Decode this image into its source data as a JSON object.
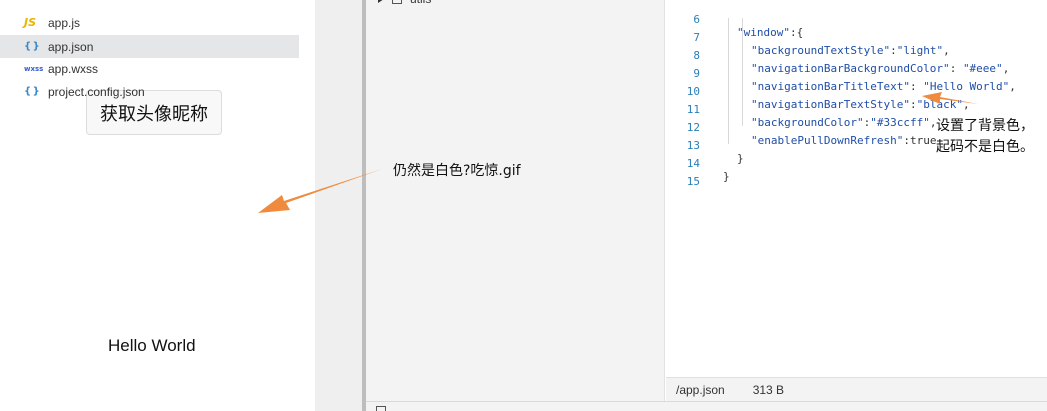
{
  "simulator": {
    "button_label": "获取头像昵称",
    "hello_text": "Hello World"
  },
  "file_tree": {
    "items": [
      {
        "icon": "JS",
        "name": "app.js",
        "selected": false
      },
      {
        "icon": "{ }",
        "name": "app.json",
        "selected": true
      },
      {
        "icon": "wxss",
        "name": "app.wxss",
        "selected": false
      },
      {
        "icon": "{ }",
        "name": "project.config.json",
        "selected": false
      }
    ],
    "folder_top": "utils"
  },
  "editor": {
    "lines": [
      {
        "num": "6",
        "text": "\"window\":{"
      },
      {
        "num": "7",
        "text": "\"backgroundTextStyle\":\"light\","
      },
      {
        "num": "8",
        "text": "\"navigationBarBackgroundColor\": \"#eee\","
      },
      {
        "num": "9",
        "text": "\"navigationBarTitleText\": \"Hello World\","
      },
      {
        "num": "10",
        "text": "\"navigationBarTextStyle\":\"black\","
      },
      {
        "num": "11",
        "text": "\"backgroundColor\":\"#33ccff\","
      },
      {
        "num": "12",
        "text": "\"enablePullDownRefresh\":true"
      },
      {
        "num": "13",
        "text": "}"
      },
      {
        "num": "14",
        "text": "}"
      },
      {
        "num": "15",
        "text": ""
      }
    ]
  },
  "statusbar": {
    "path": "/app.json",
    "size": "313 B"
  },
  "annotations": {
    "left_note": "仍然是白色?吃惊.gif",
    "right_note": "设置了背景色，起码不是白色。"
  },
  "colors": {
    "arrow": "#f08a3c",
    "line_number": "#2a7fb8",
    "string": "#1f4ea8"
  }
}
